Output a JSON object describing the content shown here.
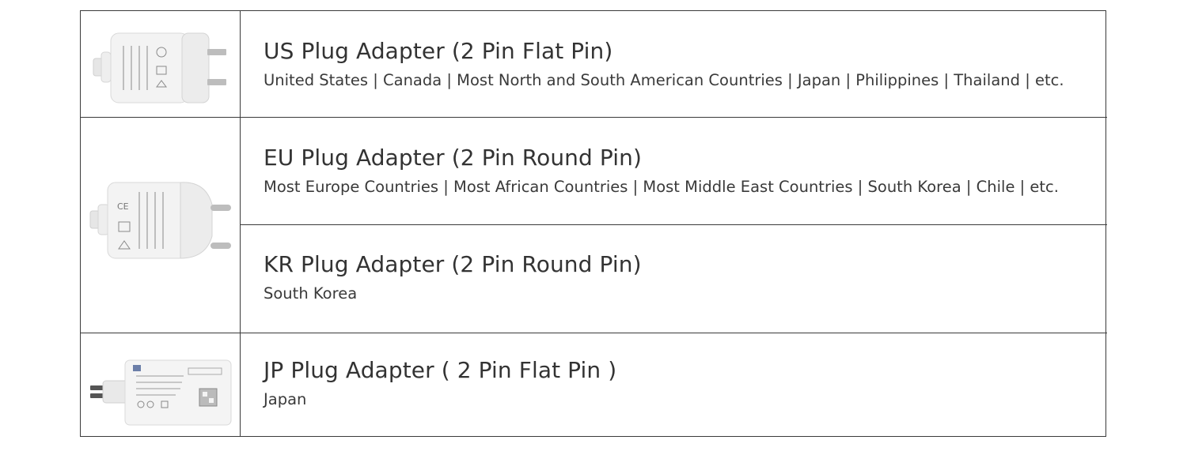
{
  "rows": [
    {
      "title": "US Plug Adapter (2 Pin Flat Pin)",
      "desc": "United States | Canada | Most North and South American Countries | Japan | Philippines | Thailand | etc."
    },
    {
      "title": "EU Plug Adapter (2 Pin Round Pin)",
      "desc": "Most Europe Countries | Most African Countries | Most Middle East Countries | South Korea | Chile | etc."
    },
    {
      "title": "KR Plug Adapter (2 Pin Round Pin)",
      "desc": "South Korea"
    },
    {
      "title": "JP Plug Adapter ( 2 Pin Flat Pin )",
      "desc": "Japan"
    }
  ],
  "images": [
    {
      "icon": "us-plug-adapter-image"
    },
    {
      "icon": "eu-kr-plug-adapter-image"
    },
    {
      "icon": "jp-plug-adapter-image"
    }
  ],
  "colors": {
    "border": "#3a3a3a",
    "text": "#333333",
    "adapter_body": "#f2f2f2",
    "pin": "#b8b8b8"
  }
}
